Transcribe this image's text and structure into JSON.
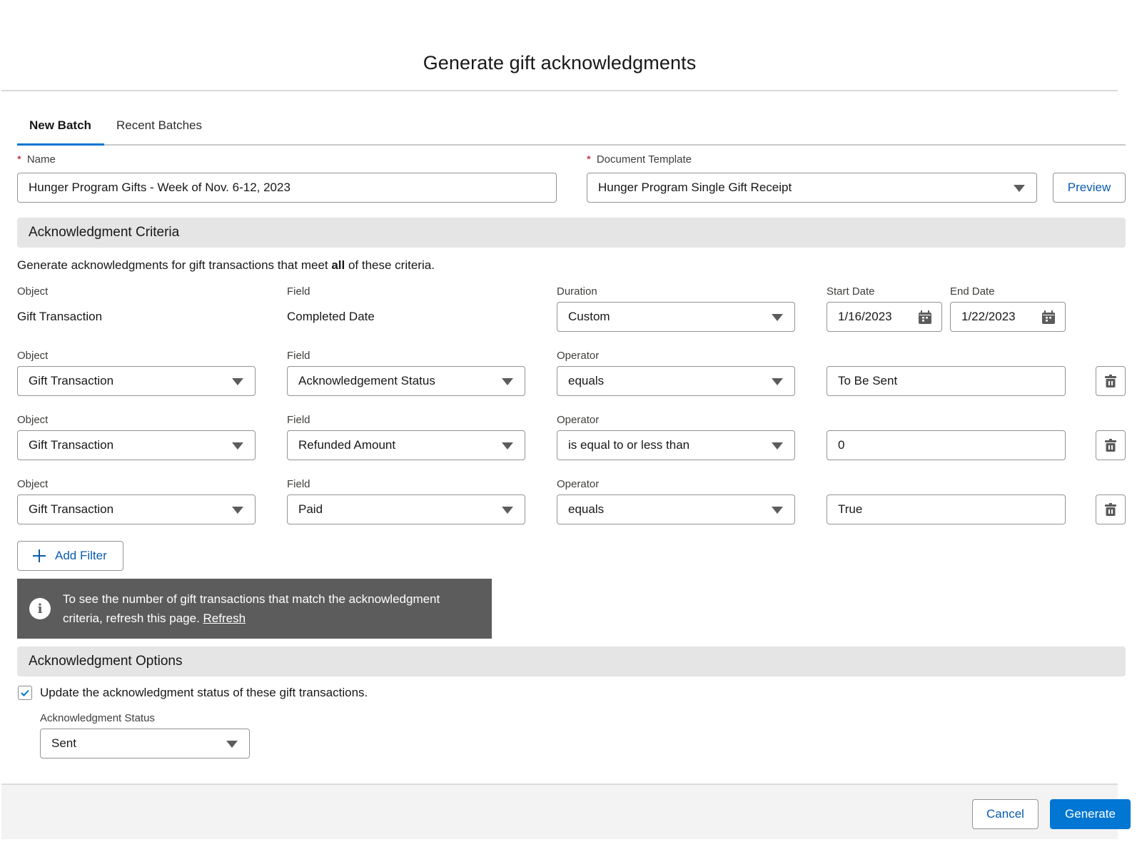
{
  "modal": {
    "title": "Generate gift acknowledgments"
  },
  "tabs": [
    {
      "label": "New Batch",
      "active": true
    },
    {
      "label": "Recent Batches",
      "active": false
    }
  ],
  "batch": {
    "name_label": "Name",
    "name_value": "Hunger Program Gifts - Week of Nov. 6-12, 2023",
    "template_label": "Document Template",
    "template_value": "Hunger Program Single Gift Receipt",
    "preview_label": "Preview"
  },
  "criteria": {
    "section_title": "Acknowledgment Criteria",
    "description_pre": "Generate acknowledgments for gift transactions that meet ",
    "description_bold": "all",
    "description_post": " of these criteria.",
    "date_row": {
      "object_label": "Object",
      "object_value": "Gift Transaction",
      "field_label": "Field",
      "field_value": "Completed Date",
      "duration_label": "Duration",
      "duration_value": "Custom",
      "start_label": "Start Date",
      "start_value": "1/16/2023",
      "end_label": "End Date",
      "end_value": "1/22/2023"
    },
    "filters": [
      {
        "object_label": "Object",
        "object": "Gift Transaction",
        "field_label": "Field",
        "field": "Acknowledgement Status",
        "operator_label": "Operator",
        "operator": "equals",
        "value": "To Be Sent"
      },
      {
        "object_label": "Object",
        "object": "Gift Transaction",
        "field_label": "Field",
        "field": "Refunded Amount",
        "operator_label": "Operator",
        "operator": "is equal to or less than",
        "value": "0"
      },
      {
        "object_label": "Object",
        "object": "Gift Transaction",
        "field_label": "Field",
        "field": "Paid",
        "operator_label": "Operator",
        "operator": "equals",
        "value": "True"
      }
    ],
    "add_filter_label": "Add Filter",
    "info_text": "To see the number of gift transactions that match the acknowledgment criteria, refresh this page. ",
    "info_link": "Refresh"
  },
  "options": {
    "section_title": "Acknowledgment Options",
    "update_checkbox_label": "Update the acknowledgment status of these gift transactions.",
    "update_checked": true,
    "status_label": "Acknowledgment Status",
    "status_value": "Sent"
  },
  "footer": {
    "cancel_label": "Cancel",
    "generate_label": "Generate"
  },
  "colors": {
    "brand": "#0176d3",
    "link": "#0b5cab",
    "required": "#ba0517",
    "banner": "#5c5c5c",
    "section_bg": "#e5e5e5"
  }
}
